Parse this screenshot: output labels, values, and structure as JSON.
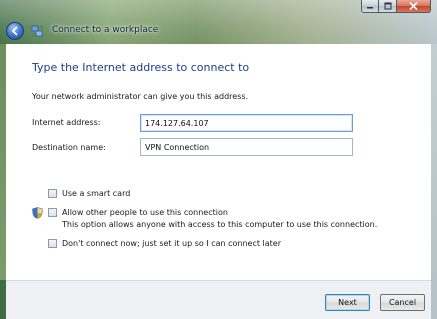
{
  "window": {
    "title": "Connect to a workplace"
  },
  "content": {
    "heading": "Type the Internet address to connect to",
    "subtext": "Your network administrator can give you this address.",
    "internet_address": {
      "label": "Internet address:",
      "value": "174.127.64.107"
    },
    "destination_name": {
      "label": "Destination name:",
      "value": "VPN Connection"
    },
    "options": {
      "smart_card": {
        "label": "Use a smart card",
        "checked": false
      },
      "allow_others": {
        "label": "Allow other people to use this connection",
        "description": "This option allows anyone with access to this computer to use this connection.",
        "checked": false
      },
      "dont_connect": {
        "label": "Don't connect now; just set it up so I can connect later",
        "checked": false
      }
    }
  },
  "footer": {
    "next_label": "Next",
    "cancel_label": "Cancel"
  },
  "colors": {
    "heading": "#1f3d8a",
    "close_button": "#c0462b",
    "back_button": "#3a6fc4",
    "default_button_border": "#3c7fb1"
  },
  "icons": {
    "back": "back-arrow-icon",
    "title": "network-connection-icon",
    "uac": "uac-shield-icon"
  }
}
